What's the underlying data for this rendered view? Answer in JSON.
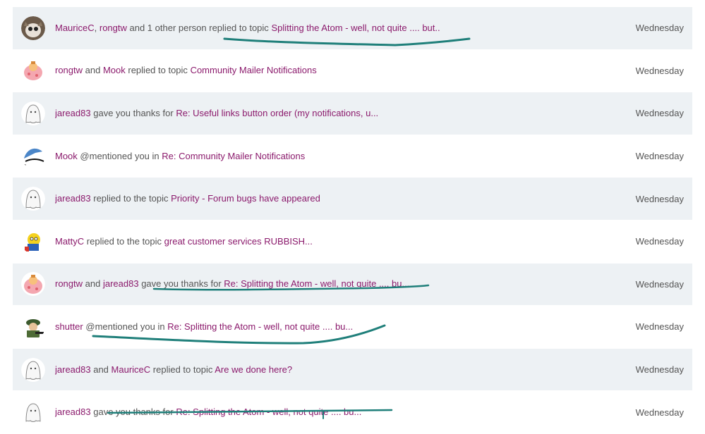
{
  "notifications": [
    {
      "actors": [
        "MauriceC",
        "rongtw"
      ],
      "connectors": [
        ", ",
        " and 1 other person "
      ],
      "verb": "replied to topic",
      "target": "Splitting the Atom - well, not quite .... but..",
      "date": "Wednesday",
      "avatar": "cat-photo-avatar"
    },
    {
      "actors": [
        "rongtw",
        "Mook"
      ],
      "connectors": [
        " and ",
        " "
      ],
      "verb": "replied to topic",
      "target": "Community Mailer Notifications",
      "date": "Wednesday",
      "avatar": "cartoon-avatar"
    },
    {
      "actors": [
        "jaread83"
      ],
      "connectors": [
        " "
      ],
      "verb": "gave you thanks for",
      "target": "Re: Useful links button order (my notifications, u...",
      "date": "Wednesday",
      "avatar": "ghost-avatar"
    },
    {
      "actors": [
        "Mook"
      ],
      "connectors": [
        " "
      ],
      "verb": "@mentioned you in",
      "target": "Re: Community Mailer Notifications",
      "date": "Wednesday",
      "avatar": "logo-avatar"
    },
    {
      "actors": [
        "jaread83"
      ],
      "connectors": [
        " "
      ],
      "verb": "replied to the topic",
      "target": "Priority - Forum bugs have appeared",
      "date": "Wednesday",
      "avatar": "ghost-avatar"
    },
    {
      "actors": [
        "MattyC"
      ],
      "connectors": [
        " "
      ],
      "verb": "replied to the topic",
      "target": "great customer services RUBBISH...",
      "date": "Wednesday",
      "avatar": "cartoon-character-avatar"
    },
    {
      "actors": [
        "rongtw",
        "jaread83"
      ],
      "connectors": [
        " and ",
        " "
      ],
      "verb": "gave you thanks for",
      "target": "Re: Splitting the Atom - well, not quite .... bu...",
      "date": "Wednesday",
      "avatar": "cartoon-avatar"
    },
    {
      "actors": [
        "shutter"
      ],
      "connectors": [
        " "
      ],
      "verb": "@mentioned you in",
      "target": "Re: Splitting the Atom - well, not quite .... bu...",
      "date": "Wednesday",
      "avatar": "soldier-avatar"
    },
    {
      "actors": [
        "jaread83",
        "MauriceC"
      ],
      "connectors": [
        " and ",
        " "
      ],
      "verb": "replied to topic",
      "target": "Are we done here?",
      "date": "Wednesday",
      "avatar": "ghost-avatar"
    },
    {
      "actors": [
        "jaread83"
      ],
      "connectors": [
        " "
      ],
      "verb": "gave you thanks for",
      "target": "Re: Splitting the Atom - well, not quite .... bu...",
      "date": "Wednesday",
      "avatar": "ghost-avatar"
    }
  ],
  "colors": {
    "link": "#8b1a6c",
    "row_alt": "#edf1f4",
    "annotation": "#1f7f7a"
  }
}
